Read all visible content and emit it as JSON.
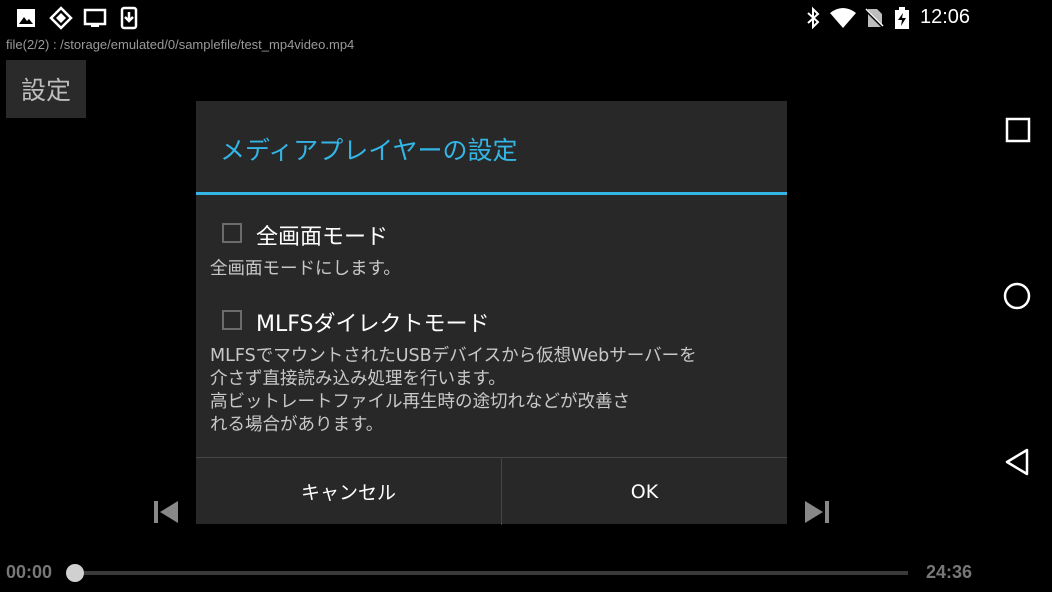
{
  "status_bar": {
    "left_icons": [
      "image-icon",
      "location-diamond-icon",
      "cast-screen-icon",
      "download-icon"
    ],
    "right_icons": [
      "bluetooth-icon",
      "wifi-icon",
      "no-sim-icon",
      "battery-charging-icon"
    ],
    "time": "12:06"
  },
  "file_path": "file(2/2) : /storage/emulated/0/samplefile/test_mp4video.mp4",
  "settings_button": {
    "label": "設定"
  },
  "dialog": {
    "title": "メディアプレイヤーの設定",
    "options": [
      {
        "label": "全画面モード",
        "checked": false,
        "description": "全画面モードにします。"
      },
      {
        "label": "MLFSダイレクトモード",
        "checked": false,
        "description": "MLFSでマウントされたUSBデバイスから仮想Webサーバーを\n介さず直接読み込み処理を行います。\n高ビットレートファイル再生時の途切れなどが改善さ\nれる場合があります。"
      }
    ],
    "cancel_label": "キャンセル",
    "ok_label": "OK"
  },
  "player": {
    "current_time": "00:00",
    "total_time": "24:36",
    "progress": 0.0
  },
  "navigation": [
    "recents-square-icon",
    "home-circle-icon",
    "back-triangle-icon"
  ],
  "colors": {
    "accent": "#33b5e5",
    "dialog_bg": "#282828",
    "background": "#000000"
  }
}
